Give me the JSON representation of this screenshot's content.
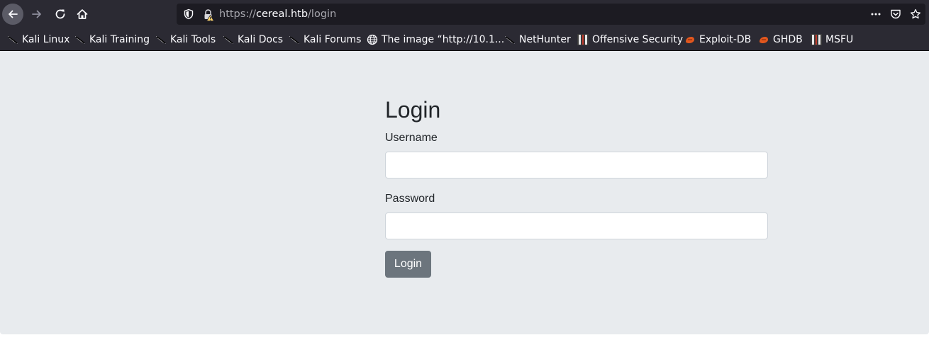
{
  "browser": {
    "url": {
      "scheme": "https://",
      "host": "cereal.htb",
      "path": "/login"
    },
    "nav_icons": [
      "back-arrow-icon",
      "forward-arrow-icon",
      "reload-icon",
      "home-icon"
    ],
    "url_icons": [
      "tracking-shield-icon",
      "insecure-lock-icon"
    ],
    "page_action_icons": [
      "more-actions-icon",
      "pocket-icon",
      "bookmark-star-icon"
    ],
    "bookmarks": [
      {
        "label": "Kali Linux",
        "icon": "kali-dragon-icon"
      },
      {
        "label": "Kali Training",
        "icon": "kali-dragon-icon"
      },
      {
        "label": "Kali Tools",
        "icon": "kali-dragon-icon"
      },
      {
        "label": "Kali Docs",
        "icon": "kali-dragon-icon"
      },
      {
        "label": "Kali Forums",
        "icon": "kali-dragon-icon"
      },
      {
        "label": "The image “http://10.1...",
        "icon": "globe-icon"
      },
      {
        "label": "NetHunter",
        "icon": "kali-dragon-icon"
      },
      {
        "label": "Offensive Security",
        "icon": "offsec-icon"
      },
      {
        "label": "Exploit-DB",
        "icon": "exploit-db-icon"
      },
      {
        "label": "GHDB",
        "icon": "exploit-db-icon"
      },
      {
        "label": "MSFU",
        "icon": "offsec-icon"
      }
    ]
  },
  "login": {
    "title": "Login",
    "username": {
      "label": "Username",
      "value": "",
      "placeholder": ""
    },
    "password": {
      "label": "Password",
      "value": "",
      "placeholder": ""
    },
    "submit_label": "Login"
  },
  "colors": {
    "toolbar": "#2b2a33",
    "urlbar": "#1c1b22",
    "page_background": "#e8ebee",
    "button": "#6c757d",
    "text": "#212529"
  }
}
